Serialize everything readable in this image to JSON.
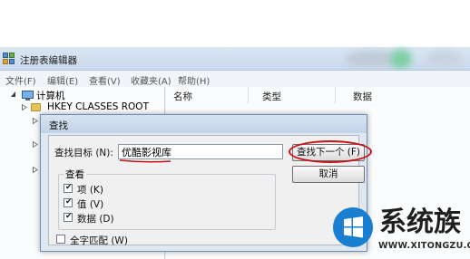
{
  "window": {
    "title": "注册表编辑器",
    "menu": [
      "文件(F)",
      "编辑(E)",
      "查看(V)",
      "收藏夹(A)",
      "帮助(H)"
    ]
  },
  "tree": {
    "root_label": "计算机",
    "first_key": "HKEY CLASSES ROOT"
  },
  "list": {
    "columns": [
      "名称",
      "类型",
      "数据"
    ]
  },
  "find_dialog": {
    "title": "查找",
    "target_label": "查找目标 (N):",
    "target_value": "优酷影视库",
    "find_next_label": "查找下一个 (F)",
    "cancel_label": "取消",
    "look_at_title": "查看",
    "options": [
      {
        "label": "项 (K)",
        "checked": true
      },
      {
        "label": "值 (V)",
        "checked": true
      },
      {
        "label": "数据 (D)",
        "checked": true
      }
    ],
    "whole_string_label": "全字匹配 (W)",
    "whole_string_checked": false
  },
  "annotations": {
    "highlight_color": "#c4141b"
  },
  "watermark": {
    "brand": "系统族",
    "url": "WWW.XITONGZU.COM"
  }
}
